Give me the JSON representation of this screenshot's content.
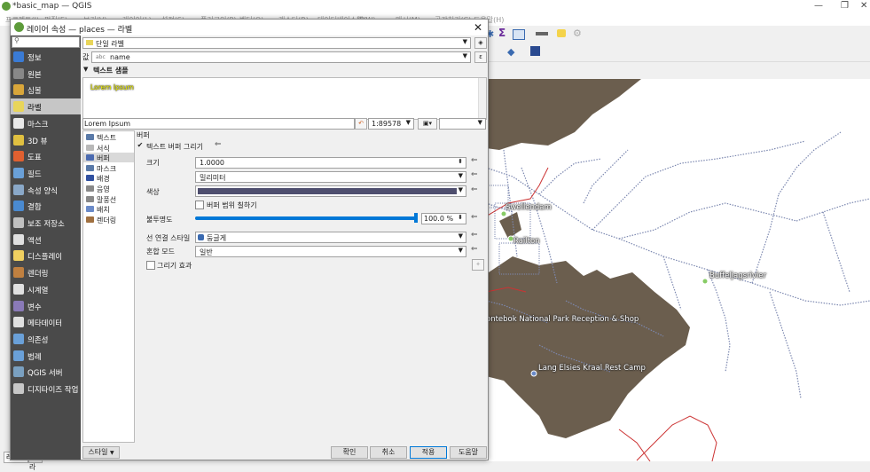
{
  "app": {
    "window_title": "*basic_map — QGIS",
    "menu_items": [
      "프로젝트(J)",
      "편집(E)",
      "보기(V)",
      "레이어(L)",
      "설정(S)",
      "플러그인(P)",
      "벡터(O)",
      "래스터(R)",
      "데이터베이스(D)",
      "웹(W)",
      "메시(M)",
      "공간처리(C)",
      "도움말(H)"
    ],
    "bottom_left_tabs": [
      "레이어",
      "브라"
    ]
  },
  "map": {
    "labels": [
      "Swellendam",
      "Railton",
      "Buffeljagsrivier",
      "ontebok National Park Reception & Shop",
      "Lang Elsies Kraal Rest Camp"
    ],
    "colors": {
      "land": "#6b5e4e",
      "roads": "#7c88b0",
      "boundary": "#cc3333"
    }
  },
  "dialog": {
    "title": "레이어 속성 — places — 라벨",
    "close": "✕",
    "search_placeholder": "",
    "sidebar": [
      {
        "label": "정보",
        "icon": "info-icon",
        "color": "#3a7bd5"
      },
      {
        "label": "원본",
        "icon": "source-icon",
        "color": "#888"
      },
      {
        "label": "심볼",
        "icon": "symbology-icon",
        "color": "#d9a63a"
      },
      {
        "label": "라벨",
        "icon": "labels-icon",
        "color": "#e8d55a",
        "selected": true
      },
      {
        "label": "마스크",
        "icon": "mask-icon",
        "color": "#e8e8e8"
      },
      {
        "label": "3D 뷰",
        "icon": "3d-view-icon",
        "color": "#e0c040"
      },
      {
        "label": "도표",
        "icon": "diagram-icon",
        "color": "#e06030"
      },
      {
        "label": "필드",
        "icon": "fields-icon",
        "color": "#6aa0d8"
      },
      {
        "label": "속성 양식",
        "icon": "attributes-form-icon",
        "color": "#8aa8c8"
      },
      {
        "label": "결합",
        "icon": "joins-icon",
        "color": "#4a8ad0"
      },
      {
        "label": "보조 저장소",
        "icon": "auxiliary-storage-icon",
        "color": "#c0c0c0"
      },
      {
        "label": "액션",
        "icon": "actions-icon",
        "color": "#e0e0e0"
      },
      {
        "label": "디스플레이",
        "icon": "display-icon",
        "color": "#f0d060"
      },
      {
        "label": "렌더링",
        "icon": "rendering-icon",
        "color": "#c08040"
      },
      {
        "label": "시계열",
        "icon": "temporal-icon",
        "color": "#e0e0e0"
      },
      {
        "label": "변수",
        "icon": "variables-icon",
        "color": "#8a7ab8"
      },
      {
        "label": "메타데이터",
        "icon": "metadata-icon",
        "color": "#e0e0e0"
      },
      {
        "label": "의존성",
        "icon": "dependencies-icon",
        "color": "#6aa0d8"
      },
      {
        "label": "범례",
        "icon": "legend-icon",
        "color": "#6aa0d8"
      },
      {
        "label": "QGIS 서버",
        "icon": "qgis-server-icon",
        "color": "#7aa0c0"
      },
      {
        "label": "디지타이즈 작업",
        "icon": "digitizing-icon",
        "color": "#c8c8c8"
      }
    ],
    "label_mode": "단일 라벨",
    "value_prefix": "값",
    "value_field": "name",
    "text_sample_header": "텍스트 샘플",
    "preview_text": "Lorem Ipsum",
    "sample_input": "Lorem Ipsum",
    "scale": "1:89578",
    "tabs": [
      {
        "label": "텍스트",
        "icon": "text-tab-icon",
        "color": "#5a7aa8"
      },
      {
        "label": "서식",
        "icon": "formatting-tab-icon",
        "color": "#b8b8b8"
      },
      {
        "label": "버퍼",
        "icon": "buffer-tab-icon",
        "color": "#4a6ab0",
        "selected": true
      },
      {
        "label": "마스크",
        "icon": "mask-tab-icon",
        "color": "#5a7aa8"
      },
      {
        "label": "배경",
        "icon": "background-tab-icon",
        "color": "#3050a0"
      },
      {
        "label": "음영",
        "icon": "shadow-tab-icon",
        "color": "#888"
      },
      {
        "label": "말풍선",
        "icon": "callouts-tab-icon",
        "color": "#888"
      },
      {
        "label": "배치",
        "icon": "placement-tab-icon",
        "color": "#6a8ac8"
      },
      {
        "label": "렌더링",
        "icon": "rendering-tab-icon",
        "color": "#a07040"
      }
    ],
    "buffer": {
      "section_title": "버퍼",
      "draw_buffer_label": "텍스트 버퍼 그리기",
      "draw_buffer_checked": true,
      "size_label": "크기",
      "size_value": "1.0000",
      "unit_value": "밀리미터",
      "color_label": "색상",
      "color_value": "#4e4e6e",
      "fill_label": "버퍼 범위 칠하기",
      "fill_checked": false,
      "opacity_label": "불투명도",
      "opacity_value": "100.0 %",
      "opacity_fraction": 1.0,
      "join_label": "선 연결 스타일",
      "join_value": "둥글게",
      "blend_label": "혼합 모드",
      "blend_value": "일반",
      "effects_label": "그리기 효과",
      "effects_checked": false
    },
    "style_button": "스타일",
    "buttons": {
      "ok": "확인",
      "cancel": "취소",
      "apply": "적용",
      "help": "도움말"
    }
  }
}
